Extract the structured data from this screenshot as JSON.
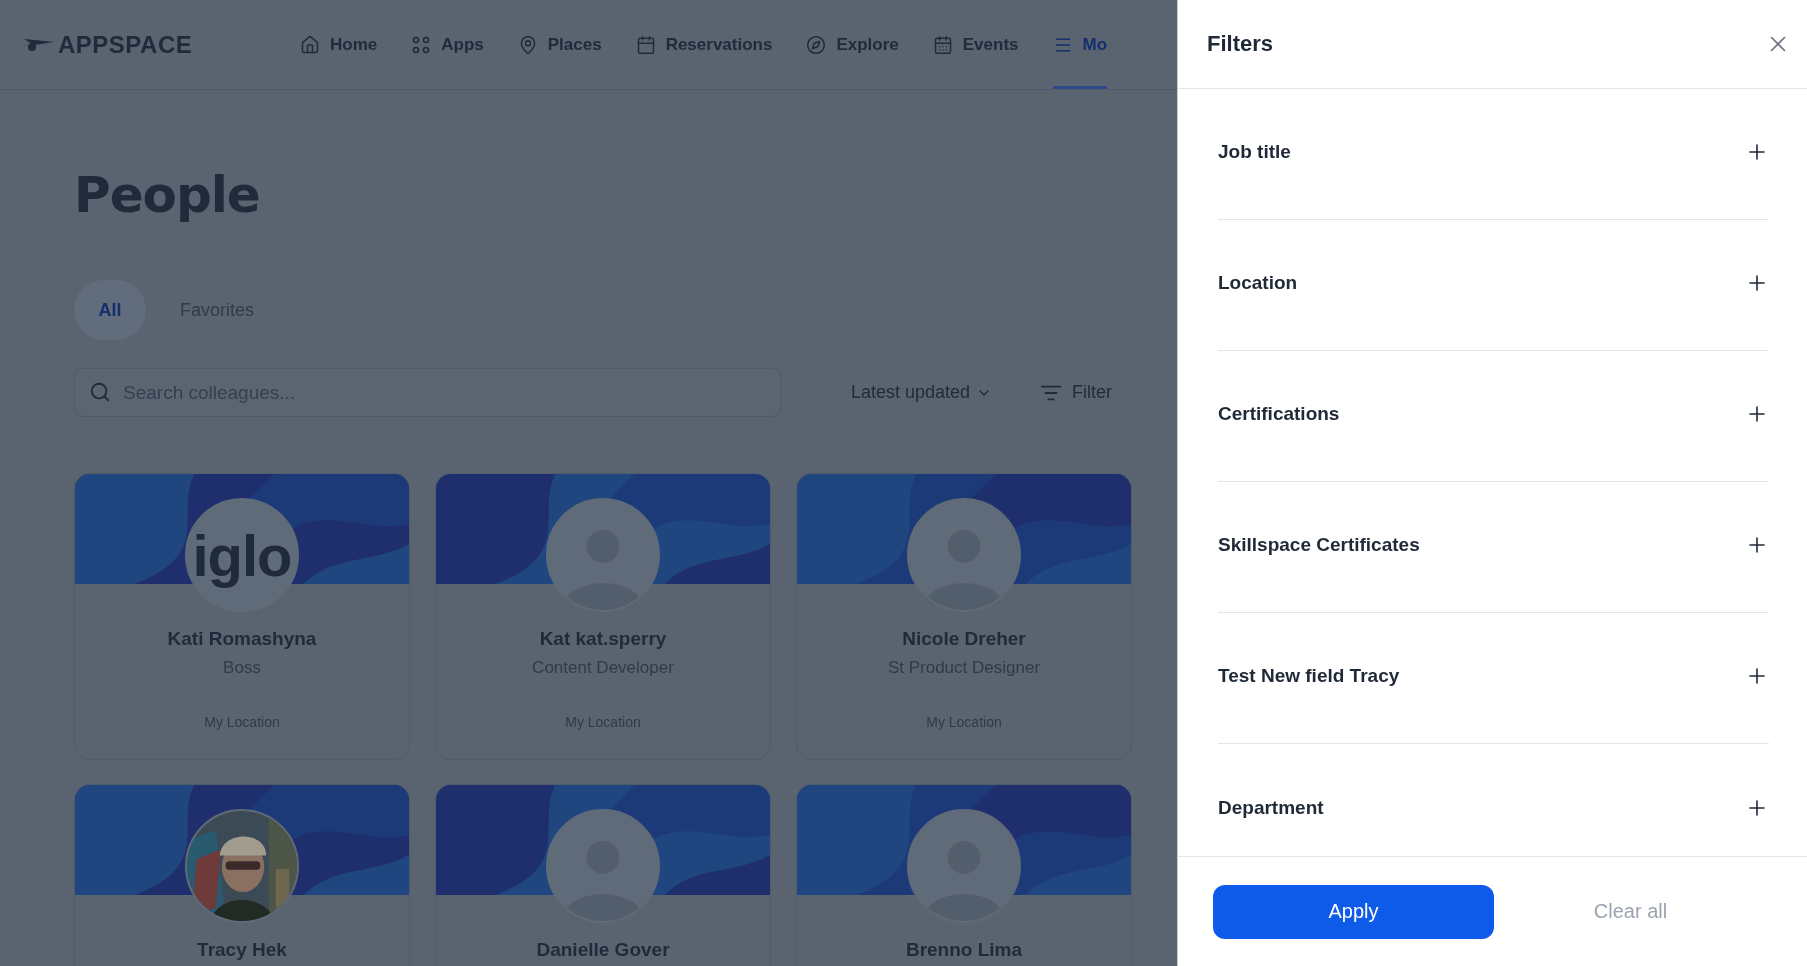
{
  "header": {
    "logo": "APPSPACE",
    "nav": [
      {
        "label": "Home",
        "selected": false
      },
      {
        "label": "Apps",
        "selected": false
      },
      {
        "label": "Places",
        "selected": false
      },
      {
        "label": "Reservations",
        "selected": false
      },
      {
        "label": "Explore",
        "selected": false
      },
      {
        "label": "Events",
        "selected": false
      },
      {
        "label": "Mo",
        "selected": true
      }
    ]
  },
  "page": {
    "title": "People",
    "tabs": [
      {
        "label": "All",
        "selected": true
      },
      {
        "label": "Favorites",
        "selected": false
      }
    ],
    "search": {
      "placeholder": "Search colleagues..."
    },
    "sort": {
      "label": "Latest updated"
    },
    "filter_button": {
      "label": "Filter"
    },
    "cards": [
      {
        "name": "Kati Romashyna",
        "role": "Boss",
        "location": "My Location",
        "kind": "logo",
        "avatar_text": "iglo"
      },
      {
        "name": "Kat kat.sperry",
        "role": "Content Developer",
        "location": "My Location",
        "kind": "placeholder"
      },
      {
        "name": "Nicole Dreher",
        "role": "St Product Designer",
        "location": "My Location",
        "kind": "placeholder"
      },
      {
        "name": "Tracy Hek",
        "kind": "picture"
      },
      {
        "name": "Danielle Gover",
        "kind": "placeholder"
      },
      {
        "name": "Brenno Lima",
        "kind": "placeholder"
      }
    ]
  },
  "filters_panel": {
    "title": "Filters",
    "sections": [
      {
        "label": "Job title",
        "expanded": false
      },
      {
        "label": "Location",
        "expanded": false
      },
      {
        "label": "Certifications",
        "expanded": false
      },
      {
        "label": "Skillspace Certificates",
        "expanded": false
      },
      {
        "label": "Test New field Tracy",
        "expanded": false
      },
      {
        "label": "Department",
        "expanded": false
      }
    ],
    "apply": "Apply",
    "clear": "Clear all"
  }
}
